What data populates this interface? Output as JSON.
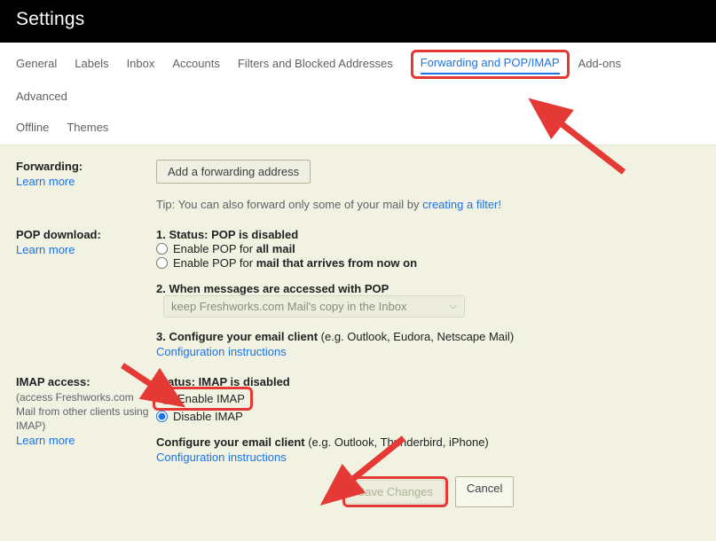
{
  "title": "Settings",
  "tabs": [
    {
      "label": "General"
    },
    {
      "label": "Labels"
    },
    {
      "label": "Inbox"
    },
    {
      "label": "Accounts"
    },
    {
      "label": "Filters and Blocked Addresses"
    },
    {
      "label": "Forwarding and POP/IMAP",
      "active": true
    },
    {
      "label": "Add-ons"
    },
    {
      "label": "Advanced"
    },
    {
      "label": "Offline"
    },
    {
      "label": "Themes"
    }
  ],
  "forwarding": {
    "heading": "Forwarding:",
    "learn": "Learn more",
    "add_button": "Add a forwarding address",
    "tip_prefix": "Tip: You can also forward only some of your mail by ",
    "tip_link": "creating a filter!"
  },
  "pop": {
    "heading": "POP download:",
    "learn": "Learn more",
    "status_label": "1. Status: ",
    "status_value": "POP is disabled",
    "opt1_prefix": "Enable POP for ",
    "opt1_bold": "all mail",
    "opt2_prefix": "Enable POP for ",
    "opt2_bold": "mail that arrives from now on",
    "step2": "2. When messages are accessed with POP",
    "select_value": "keep Freshworks.com Mail's copy in the Inbox",
    "step3_prefix": "3. Configure your email client ",
    "step3_rest": "(e.g. Outlook, Eudora, Netscape Mail)",
    "config_link": "Configuration instructions"
  },
  "imap": {
    "heading": "IMAP access:",
    "sub": "(access Freshworks.com Mail from other clients using IMAP)",
    "learn": "Learn more",
    "status_label": "Status: ",
    "status_value": "IMAP is disabled",
    "opt_enable": "Enable IMAP",
    "opt_disable": "Disable IMAP",
    "conf_prefix": "Configure your email client ",
    "conf_rest": "(e.g. Outlook, Thunderbird, iPhone)",
    "config_link": "Configuration instructions"
  },
  "footer": {
    "save": "Save Changes",
    "cancel": "Cancel"
  }
}
